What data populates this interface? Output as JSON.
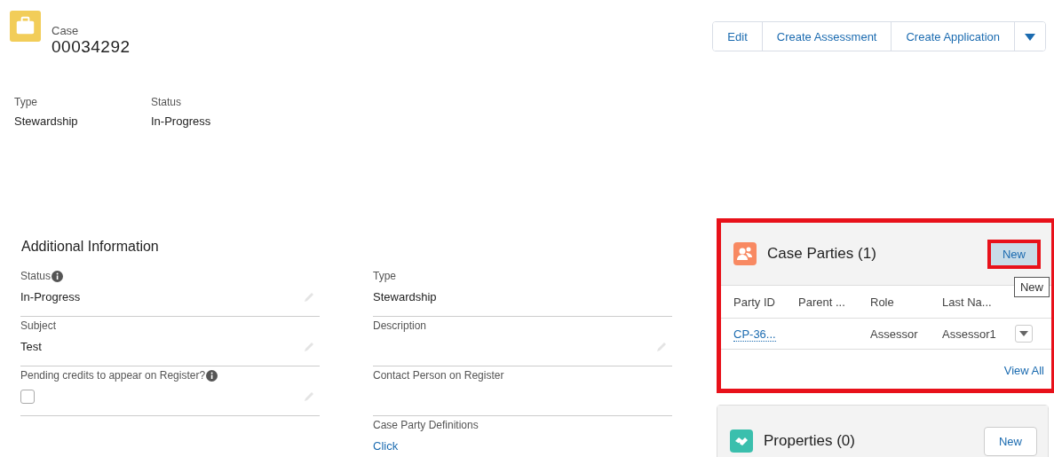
{
  "record": {
    "object_label": "Case",
    "number": "00034292"
  },
  "actions": {
    "buttons": [
      "Edit",
      "Create Assessment",
      "Create Application"
    ]
  },
  "highlights": [
    {
      "label": "Type",
      "value": "Stewardship"
    },
    {
      "label": "Status",
      "value": "In-Progress"
    }
  ],
  "additional_information": {
    "title": "Additional Information",
    "left_fields": [
      {
        "kind": "text",
        "label": "Status",
        "info": true,
        "value": "In-Progress"
      },
      {
        "kind": "text",
        "label": "Subject",
        "info": false,
        "value": "Test"
      },
      {
        "kind": "checkbox",
        "label": "Pending credits to appear on Register?",
        "info": true,
        "checked": false
      }
    ],
    "right_fields": [
      {
        "kind": "text",
        "label": "Type",
        "value": "Stewardship",
        "editable": false
      },
      {
        "kind": "text",
        "label": "Description",
        "editable": true
      },
      {
        "kind": "text",
        "label": "Contact Person on Register",
        "editable": false
      },
      {
        "kind": "link",
        "label": "Case Party Definitions",
        "value": "Click",
        "editable": false
      }
    ]
  },
  "case_parties": {
    "title": "Case Parties (1)",
    "new_button": "New",
    "highlighted": true,
    "button_highlighted": true,
    "tooltip": "New",
    "columns": [
      "Party ID",
      "Parent ...",
      "Role",
      "Last Na..."
    ],
    "rows": [
      {
        "party_id": "CP-36...",
        "role": "Assessor",
        "last_name": "Assessor1"
      }
    ],
    "view_all": "View All"
  },
  "properties": {
    "title": "Properties (0)",
    "new_button": "New"
  }
}
